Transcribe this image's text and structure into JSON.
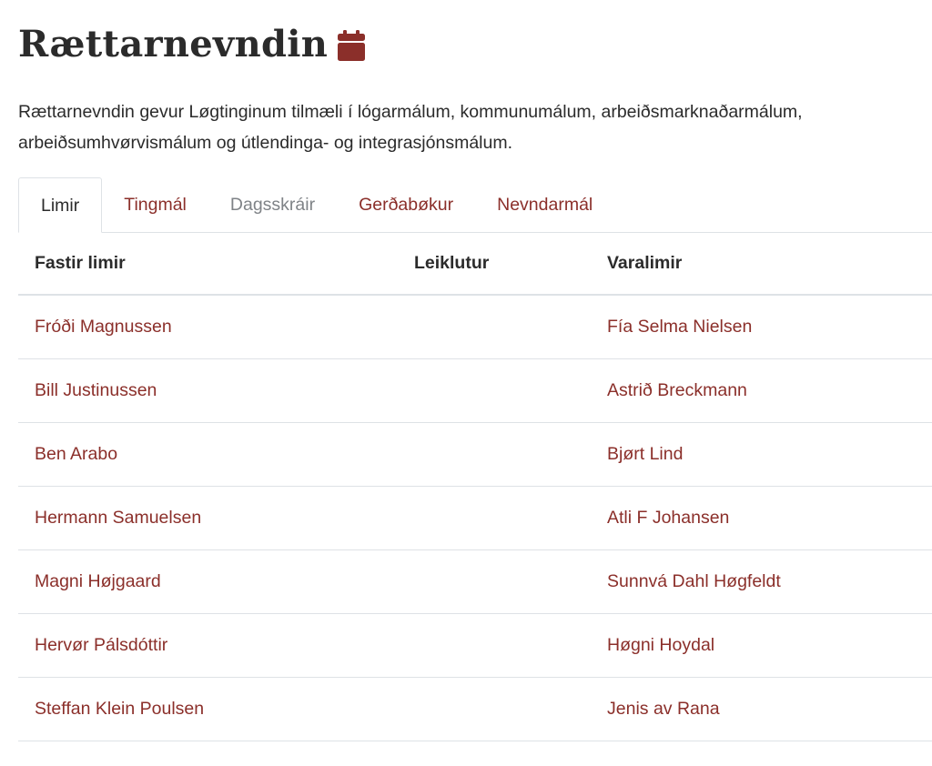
{
  "page": {
    "title": "Rættarnevndin",
    "title_icon": "calendar-icon",
    "description": "Rættarnevndin gevur Løgtinginum tilmæli í lógarmálum, kommunumálum, arbeiðsmarknaðarmálum, arbeiðsumhvørvismálum og útlendinga- og integrasjónsmálum."
  },
  "colors": {
    "accent": "#8b2f2a",
    "text": "#2b2b2b",
    "muted": "#7f8387",
    "border": "#dee2e6"
  },
  "tabs": [
    {
      "label": "Limir",
      "state": "active"
    },
    {
      "label": "Tingmál",
      "state": "link"
    },
    {
      "label": "Dagsskráir",
      "state": "disabled"
    },
    {
      "label": "Gerðabøkur",
      "state": "link"
    },
    {
      "label": "Nevndarmál",
      "state": "link"
    }
  ],
  "table": {
    "headers": [
      "Fastir limir",
      "Leiklutur",
      "Varalimir"
    ],
    "rows": [
      {
        "member": "Fróði Magnussen",
        "role": "",
        "substitute": "Fía Selma Nielsen"
      },
      {
        "member": "Bill Justinussen",
        "role": "",
        "substitute": "Astrið Breckmann"
      },
      {
        "member": "Ben Arabo",
        "role": "",
        "substitute": "Bjørt Lind"
      },
      {
        "member": "Hermann Samuelsen",
        "role": "",
        "substitute": "Atli F Johansen"
      },
      {
        "member": "Magni Højgaard",
        "role": "",
        "substitute": "Sunnvá Dahl Høgfeldt"
      },
      {
        "member": "Hervør Pálsdóttir",
        "role": "",
        "substitute": "Høgni Hoydal"
      },
      {
        "member": "Steffan Klein Poulsen",
        "role": "",
        "substitute": "Jenis av Rana"
      }
    ]
  }
}
